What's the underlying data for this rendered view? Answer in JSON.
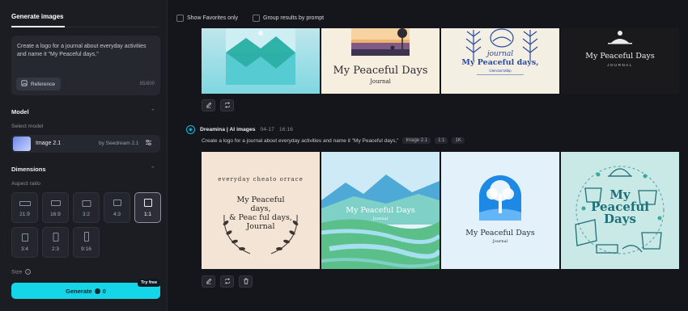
{
  "sidebar": {
    "tab": "Generate images",
    "prompt": "Create a logo for a journal about everyday activities and name it \"My Peaceful days,\"",
    "reference_label": "Reference",
    "counter": "85/800",
    "model_section": "Model",
    "select_model_label": "Select model",
    "model_name": "Image 2.1",
    "model_by": "by Seedream 2.1",
    "dimensions_section": "Dimensions",
    "aspect_ratio_label": "Aspect ratio",
    "ratios": [
      "21:9",
      "16:9",
      "3:2",
      "4:3",
      "1:1",
      "3:4",
      "2:3",
      "9:16"
    ],
    "selected_ratio": "1:1",
    "size_label": "Size",
    "generate_label": "Generate",
    "generate_cost": "0",
    "try_free": "Try free"
  },
  "topbar": {
    "show_favorites": "Show Favorites only",
    "group_results": "Group results by prompt"
  },
  "generation": {
    "source": "Dreamina | AI images",
    "date": "04-17",
    "time": "16:16",
    "prompt": "Create a logo for a journal about everyday activities and name it \"My Peaceful days,\"",
    "chips": [
      "Image 2.1",
      "1:1",
      "1K"
    ]
  },
  "images_top": {
    "img2_title": "My Peaceful Days",
    "img2_sub": "Journal",
    "img3_title_a": "journal",
    "img3_title_b": "My Peaceful days,",
    "img3_sub": "Clenctal Mibp",
    "img4_title": "My Peaceful Days",
    "img4_sub": "JOURNAL"
  },
  "images_bottom": {
    "img1_arc": "everyday cheato orrace",
    "img1_lines": [
      "My Peaceful",
      "days,",
      "& Peac ful days,",
      "Journal"
    ],
    "img2_title": "My Peaceful Days",
    "img2_sub": "Journal",
    "img3_title": "My Peaceful Days",
    "img3_sub": "Journal",
    "img4_lines": [
      "My",
      "Peaceful",
      "Days"
    ]
  },
  "colors": {
    "accent": "#14d6e8",
    "background": "#14161b",
    "sidebar": "#1b1d23"
  },
  "icons": {
    "reference": "image-icon",
    "settings": "sliders-icon",
    "edit": "pencil-icon",
    "regenerate": "repeat-icon",
    "delete": "trash-icon",
    "info": "info-icon"
  }
}
